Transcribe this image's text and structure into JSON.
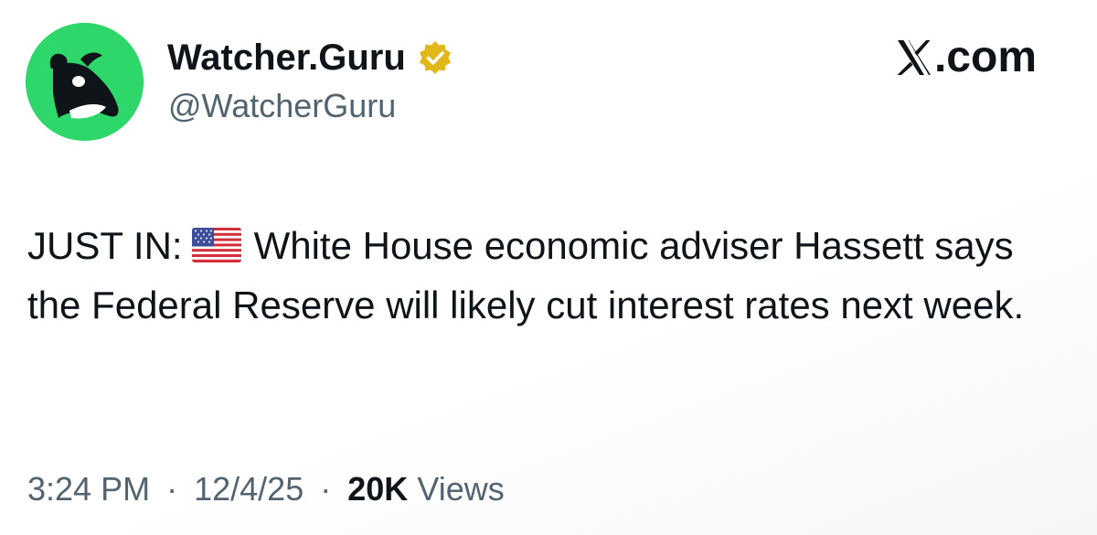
{
  "post": {
    "author": {
      "display_name": "Watcher.Guru",
      "handle": "@WatcherGuru",
      "verified_icon": "verified-badge-icon",
      "avatar_icon": "whale-icon",
      "avatar_color": "#2ed76a"
    },
    "brand": {
      "x_glyph_icon": "x-logo-icon",
      "domain_suffix": ".com"
    },
    "text": {
      "prefix": "JUST IN:",
      "flag_icon": "us-flag-icon",
      "body": "White House economic adviser Hassett says the Federal Reserve will likely cut interest rates next week."
    },
    "meta": {
      "time": "3:24 PM",
      "date": "12/4/25",
      "separator": "·",
      "views_count": "20K",
      "views_label": "Views"
    }
  },
  "colors": {
    "text_primary": "#0f1419",
    "text_secondary": "#536471",
    "verified_gold": "#e2b719"
  }
}
